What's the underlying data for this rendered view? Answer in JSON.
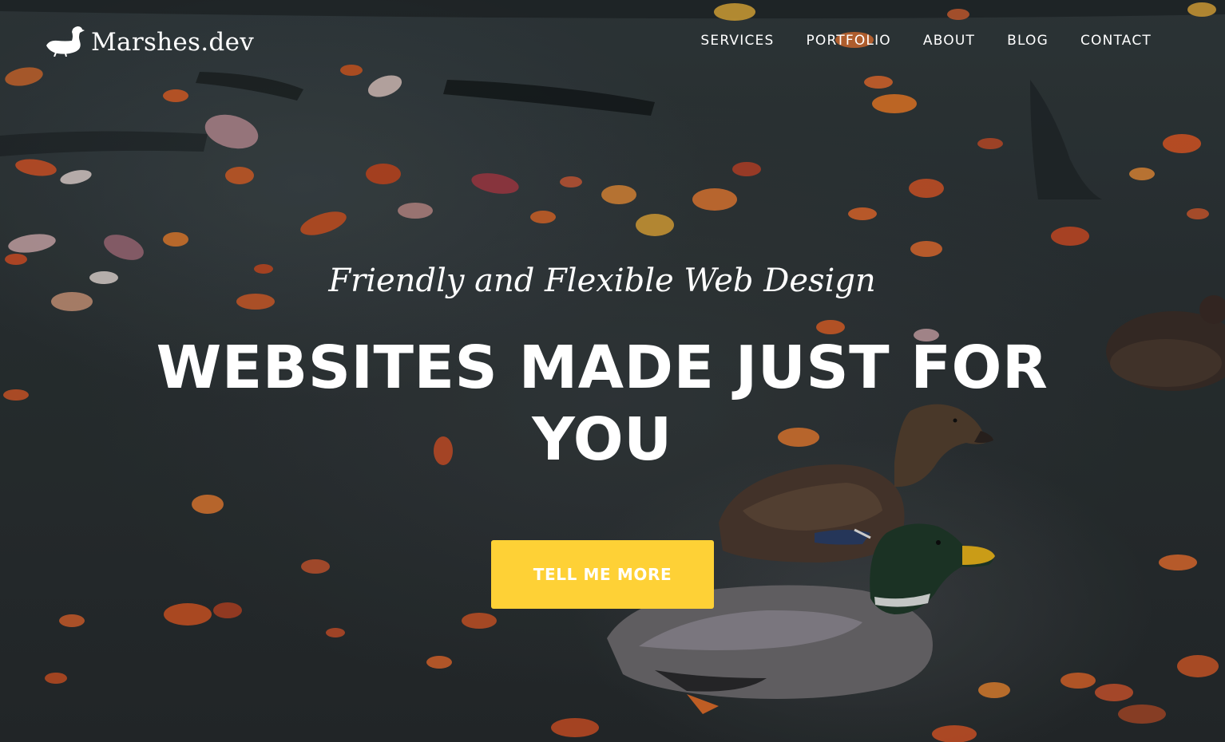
{
  "brand": {
    "name": "Marshes.dev",
    "logo_icon": "duck-icon"
  },
  "nav": {
    "items": [
      {
        "label": "SERVICES"
      },
      {
        "label": "PORTFOLIO"
      },
      {
        "label": "ABOUT"
      },
      {
        "label": "BLOG"
      },
      {
        "label": "CONTACT"
      }
    ]
  },
  "hero": {
    "subheading": "Friendly and Flexible Web Design",
    "heading_line1": "WEBSITES MADE JUST FOR",
    "heading_line2": "YOU",
    "cta_label": "TELL ME MORE",
    "background_image": "ducks-on-pond-with-autumn-leaves"
  },
  "colors": {
    "accent": "#fed136",
    "text": "#ffffff"
  }
}
